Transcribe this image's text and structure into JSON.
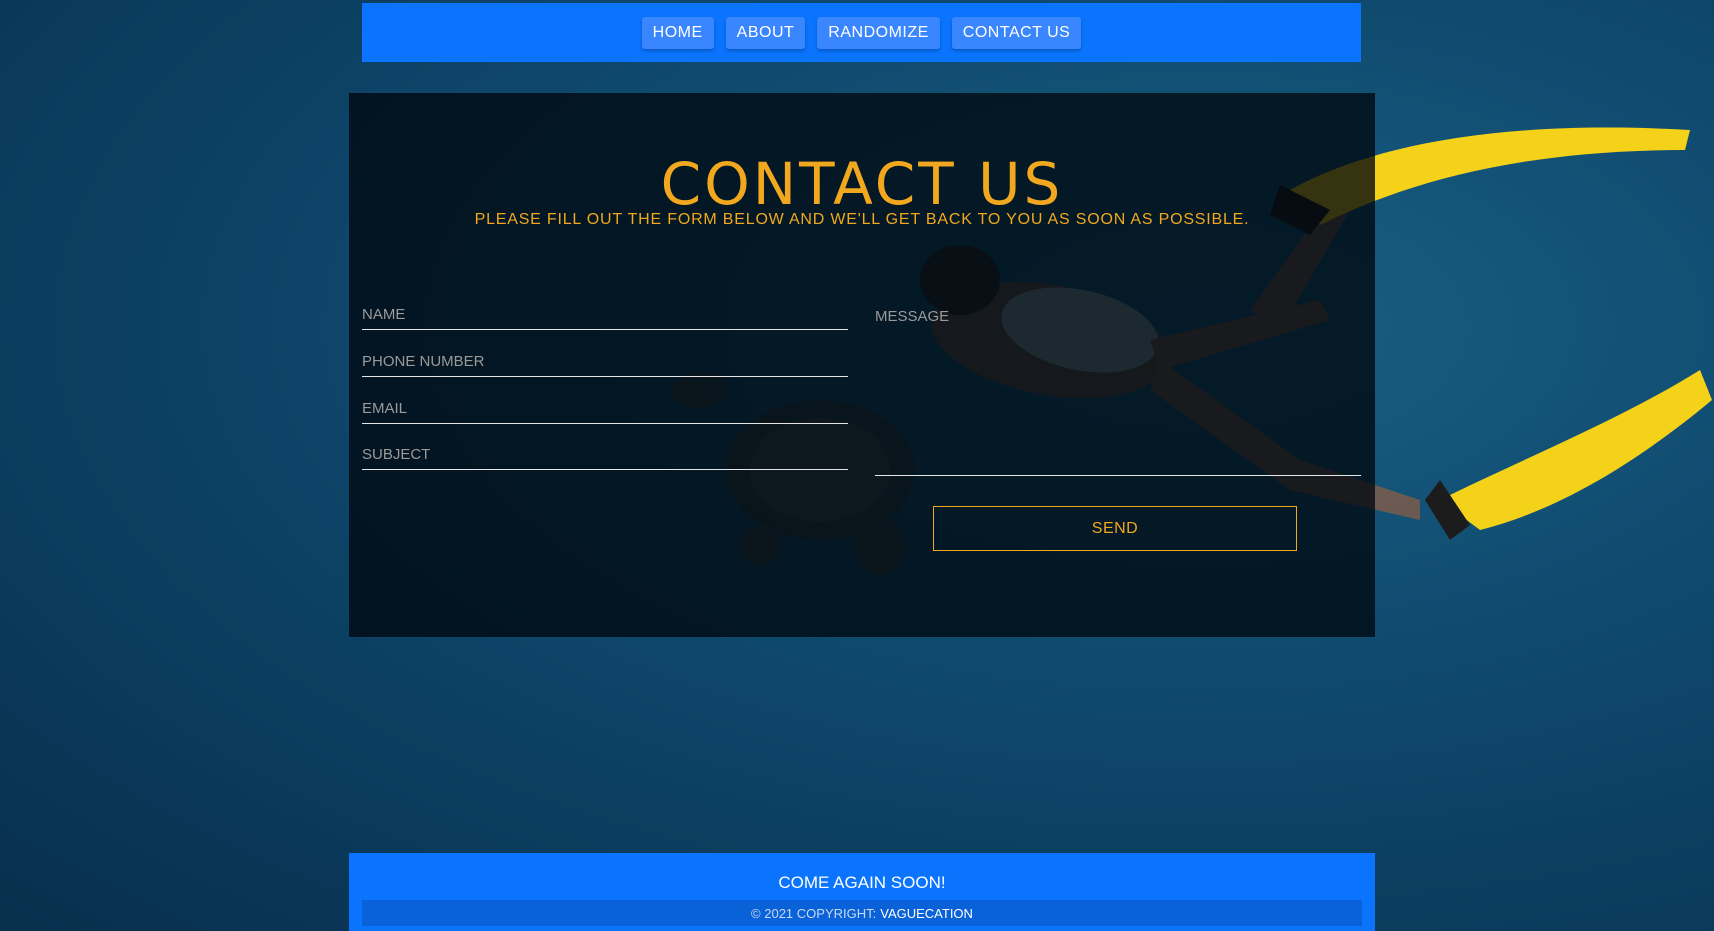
{
  "nav": {
    "items": [
      {
        "label": "HOME"
      },
      {
        "label": "ABOUT"
      },
      {
        "label": "RANDOMIZE"
      },
      {
        "label": "CONTACT US"
      }
    ]
  },
  "page": {
    "title": "CONTACT US",
    "subtitle": "PLEASE FILL OUT THE FORM BELOW AND WE'LL GET BACK TO YOU AS SOON AS POSSIBLE."
  },
  "form": {
    "name_placeholder": "NAME",
    "phone_placeholder": "PHONE NUMBER",
    "email_placeholder": "EMAIL",
    "subject_placeholder": "SUBJECT",
    "message_placeholder": "MESSAGE",
    "send_label": "SEND"
  },
  "footer": {
    "message": "COME AGAIN SOON!",
    "copyright": "© 2021 COPYRIGHT:",
    "brand": "VAGUECATION"
  },
  "colors": {
    "accent": "#f1a81e",
    "nav_bg": "#0a74ff",
    "nav_button": "#3a86ff"
  }
}
